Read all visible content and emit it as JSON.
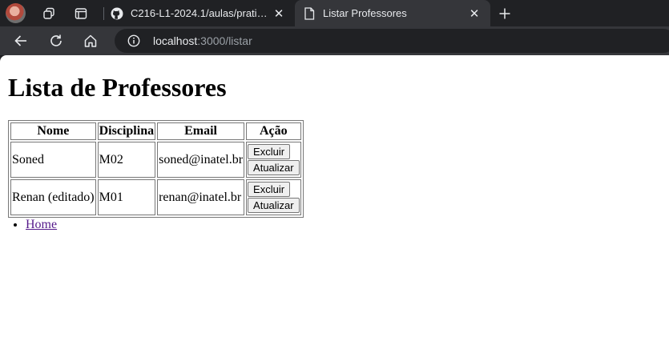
{
  "browser": {
    "tabs": [
      {
        "title": "C216-L1-2024.1/aulas/pratica-5/f",
        "favicon": "github-icon",
        "active": false
      },
      {
        "title": "Listar Professores",
        "favicon": "page-icon",
        "active": true
      }
    ],
    "url": {
      "host": "localhost",
      "path": ":3000/listar"
    }
  },
  "page": {
    "heading": "Lista de Professores",
    "table": {
      "headers": [
        "Nome",
        "Disciplina",
        "Email",
        "Ação"
      ],
      "rows": [
        {
          "nome": "Soned",
          "disciplina": "M02",
          "email": "soned@inatel.br"
        },
        {
          "nome": "Renan (editado)",
          "disciplina": "M01",
          "email": "renan@inatel.br"
        }
      ],
      "delete_label": "Excluir",
      "update_label": "Atualizar"
    },
    "links": [
      {
        "label": "Home"
      }
    ]
  }
}
